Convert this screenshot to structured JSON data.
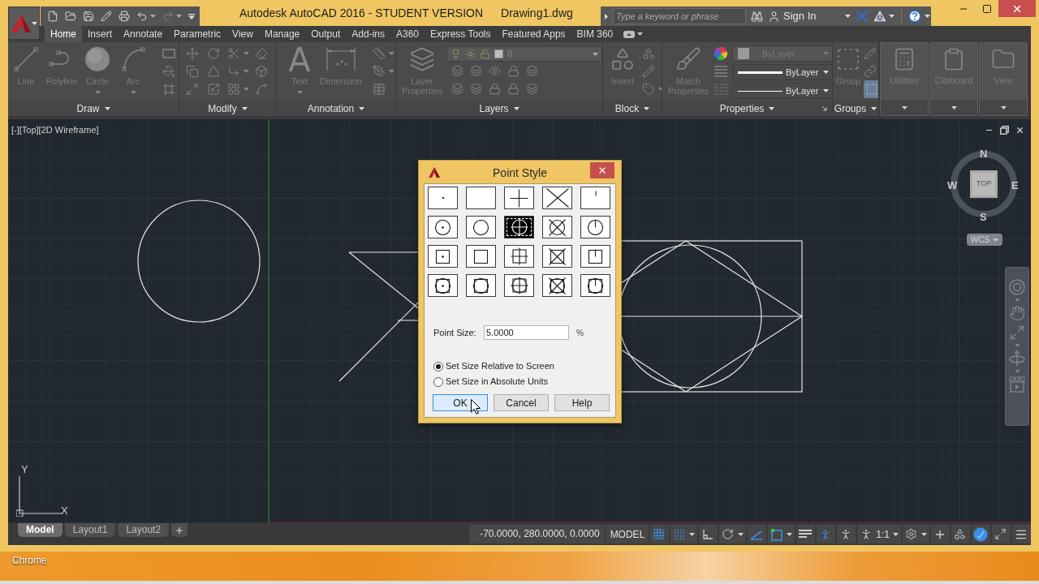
{
  "title_bar": {
    "title": "Autodesk AutoCAD 2016 - STUDENT VERSION",
    "file_name": "Drawing1.dwg",
    "search": {
      "placeholder": "Type a keyword or phrase"
    },
    "sign_in": "Sign In"
  },
  "ribbon": {
    "disabled": true,
    "tabs": [
      {
        "label": "Home",
        "selected": true
      },
      {
        "label": "Insert",
        "selected": false
      },
      {
        "label": "Annotate",
        "selected": false
      },
      {
        "label": "Parametric",
        "selected": false
      },
      {
        "label": "View",
        "selected": false
      },
      {
        "label": "Manage",
        "selected": false
      },
      {
        "label": "Output",
        "selected": false
      },
      {
        "label": "Add-ins",
        "selected": false
      },
      {
        "label": "A360",
        "selected": false
      },
      {
        "label": "Express Tools",
        "selected": false
      },
      {
        "label": "Featured Apps",
        "selected": false
      },
      {
        "label": "BIM 360",
        "selected": false
      }
    ],
    "panels": [
      {
        "kind": "draw",
        "label": "Draw",
        "tools": [
          {
            "kind": "line",
            "label": "Line",
            "menu": false
          },
          {
            "kind": "polyline",
            "label": "Polyline",
            "menu": false
          },
          {
            "kind": "circle",
            "label": "Circle",
            "menu": true
          },
          {
            "kind": "arc",
            "label": "Arc",
            "menu": true
          }
        ]
      },
      {
        "kind": "modify",
        "label": "Modify"
      },
      {
        "kind": "annotation",
        "label": "Annotation",
        "tools": [
          {
            "kind": "text",
            "label": "Text",
            "glyph": "A",
            "menu": true
          },
          {
            "kind": "dimension",
            "label": "Dimension",
            "menu": false
          }
        ]
      },
      {
        "kind": "layers",
        "label": "Layers",
        "current_layer": "0",
        "tools": [
          {
            "kind": "layer-properties",
            "label": "Layer Properties",
            "menu": false
          }
        ]
      },
      {
        "kind": "block",
        "label": "Block",
        "tools": [
          {
            "kind": "insert",
            "label": "Insert",
            "menu": false
          }
        ]
      },
      {
        "kind": "properties",
        "label": "Properties",
        "tools": [
          {
            "kind": "match-properties",
            "label": "Match Properties",
            "menu": false
          }
        ],
        "dropdowns": [
          {
            "kind": "color",
            "value": "ByLayer",
            "disabled": true
          },
          {
            "kind": "lineweight",
            "value": "ByLayer",
            "disabled": false
          },
          {
            "kind": "linetype",
            "value": "ByLayer",
            "disabled": false
          }
        ]
      },
      {
        "kind": "groups",
        "label": "Groups",
        "tools": [
          {
            "kind": "group",
            "label": "Group",
            "menu": false
          }
        ]
      },
      {
        "kind": "collapsed",
        "tools": [
          {
            "kind": "utilities",
            "label": "Utilities",
            "menu": false
          }
        ]
      },
      {
        "kind": "collapsed",
        "tools": [
          {
            "kind": "clipboard",
            "label": "Clipboard",
            "menu": false
          }
        ]
      },
      {
        "kind": "collapsed",
        "tools": [
          {
            "kind": "view",
            "label": "View",
            "menu": false
          }
        ]
      }
    ]
  },
  "viewport": {
    "label": "[-][Top][2D Wireframe]",
    "view_cube": {
      "face": "TOP",
      "north": "N",
      "east": "E",
      "south": "S",
      "west": "W",
      "ucs_menu": "WCS"
    },
    "ucs_icon": {
      "y_label": "Y",
      "x_label": "X"
    }
  },
  "dialog": {
    "title": "Point Style",
    "styles": [
      {
        "selected": false
      },
      {
        "selected": false
      },
      {
        "selected": false
      },
      {
        "selected": false
      },
      {
        "selected": false
      },
      {
        "selected": false
      },
      {
        "selected": false
      },
      {
        "selected": true
      },
      {
        "selected": false
      },
      {
        "selected": false
      },
      {
        "selected": false
      },
      {
        "selected": false
      },
      {
        "selected": false
      },
      {
        "selected": false
      },
      {
        "selected": false
      },
      {
        "selected": false
      },
      {
        "selected": false
      },
      {
        "selected": false
      },
      {
        "selected": false
      },
      {
        "selected": false
      }
    ],
    "point_size": {
      "label": "Point Size:",
      "value": "5.0000",
      "unit": "%"
    },
    "size_modes": [
      {
        "label": "Set Size Relative to Screen",
        "selected": true
      },
      {
        "label": "Set Size in Absolute Units",
        "selected": false
      }
    ],
    "buttons": [
      {
        "label": "OK",
        "highlighted": true
      },
      {
        "label": "Cancel",
        "highlighted": false
      },
      {
        "label": "Help",
        "highlighted": false
      }
    ]
  },
  "layout_tabs": [
    {
      "label": "Model",
      "selected": true
    },
    {
      "label": "Layout1",
      "selected": false
    },
    {
      "label": "Layout2",
      "selected": false
    }
  ],
  "status_bar": {
    "coordinates": "-70.0000, 280.0000, 0.0000",
    "space": "MODEL",
    "tools": [
      {
        "kind": "grid",
        "on": true,
        "menu": false
      },
      {
        "kind": "snap",
        "on": true,
        "menu": true
      },
      {
        "kind": "ortho",
        "on": false,
        "menu": false
      },
      {
        "kind": "polar",
        "on": false,
        "menu": true
      },
      {
        "kind": "tracking",
        "on": true,
        "menu": false
      },
      {
        "kind": "osnap",
        "on": true,
        "menu": true
      },
      {
        "kind": "lineweight",
        "on": false,
        "menu": false
      },
      {
        "kind": "annotation-visibility",
        "on": true,
        "menu": false
      },
      {
        "kind": "autoscale",
        "on": false,
        "menu": false
      },
      {
        "kind": "annotation-scale",
        "on": false,
        "menu": true,
        "label": "1:1"
      },
      {
        "kind": "workspace",
        "on": false,
        "menu": true
      },
      {
        "kind": "monitor",
        "on": false,
        "menu": false
      },
      {
        "kind": "isolate",
        "on": false,
        "menu": false
      },
      {
        "kind": "hardware",
        "on": true,
        "menu": false
      },
      {
        "kind": "clean-screen",
        "on": false,
        "menu": false
      },
      {
        "kind": "customize",
        "on": false,
        "menu": false
      }
    ]
  },
  "desktop": {
    "icon_label": "Chrome"
  }
}
